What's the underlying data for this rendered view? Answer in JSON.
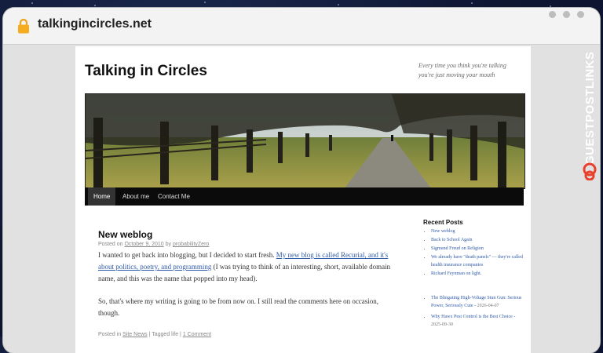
{
  "browser": {
    "url": "talkingincircles.net"
  },
  "blog": {
    "title": "Talking in Circles",
    "tagline": "Every time you think you're talking you're just moving your mouth",
    "nav": [
      "Home",
      "About me",
      "Contact Me"
    ]
  },
  "post": {
    "title": "New weblog",
    "meta_prefix": "Posted on",
    "meta_date": "October 9, 2010",
    "meta_by": "by",
    "meta_author": "probabilityZero",
    "p1_before": "I wanted to get back into blogging, but I decided to start fresh.",
    "p1_link": "My new blog is called Recurial, and it's about politics, poetry, and programming",
    "p1_after": "(I was trying to think of an interesting, short, available domain name, and this was the name that popped into my head).",
    "p2": "So, that's where my writing is going to be from now on. I still read the comments here on occasion, though.",
    "foot_posted": "Posted in",
    "foot_cat": "Site News",
    "foot_sep1": "| Tagged life |",
    "foot_comment": "1 Comment"
  },
  "sidebar": {
    "recent_title": "Recent Posts",
    "recent": [
      "New weblog",
      "Back to School Again",
      "Sigmund Freud on Religion",
      "We already have \"death panels\" — they're called health insurance companies",
      "Richard Feynman on light."
    ],
    "extra": [
      {
        "text": "The Blingating High-Voltage Stun Gun: Serious Power, Seriously Cute -",
        "date": "2026-04-07"
      },
      {
        "text": "Why Hawx Pest Control is the Best Choice -",
        "date": "2025-09-30"
      }
    ]
  },
  "brand": {
    "name": "GUESTPOSTLINKS"
  },
  "colors": {
    "accent": "#e8402c",
    "link": "#2f5aa8"
  }
}
